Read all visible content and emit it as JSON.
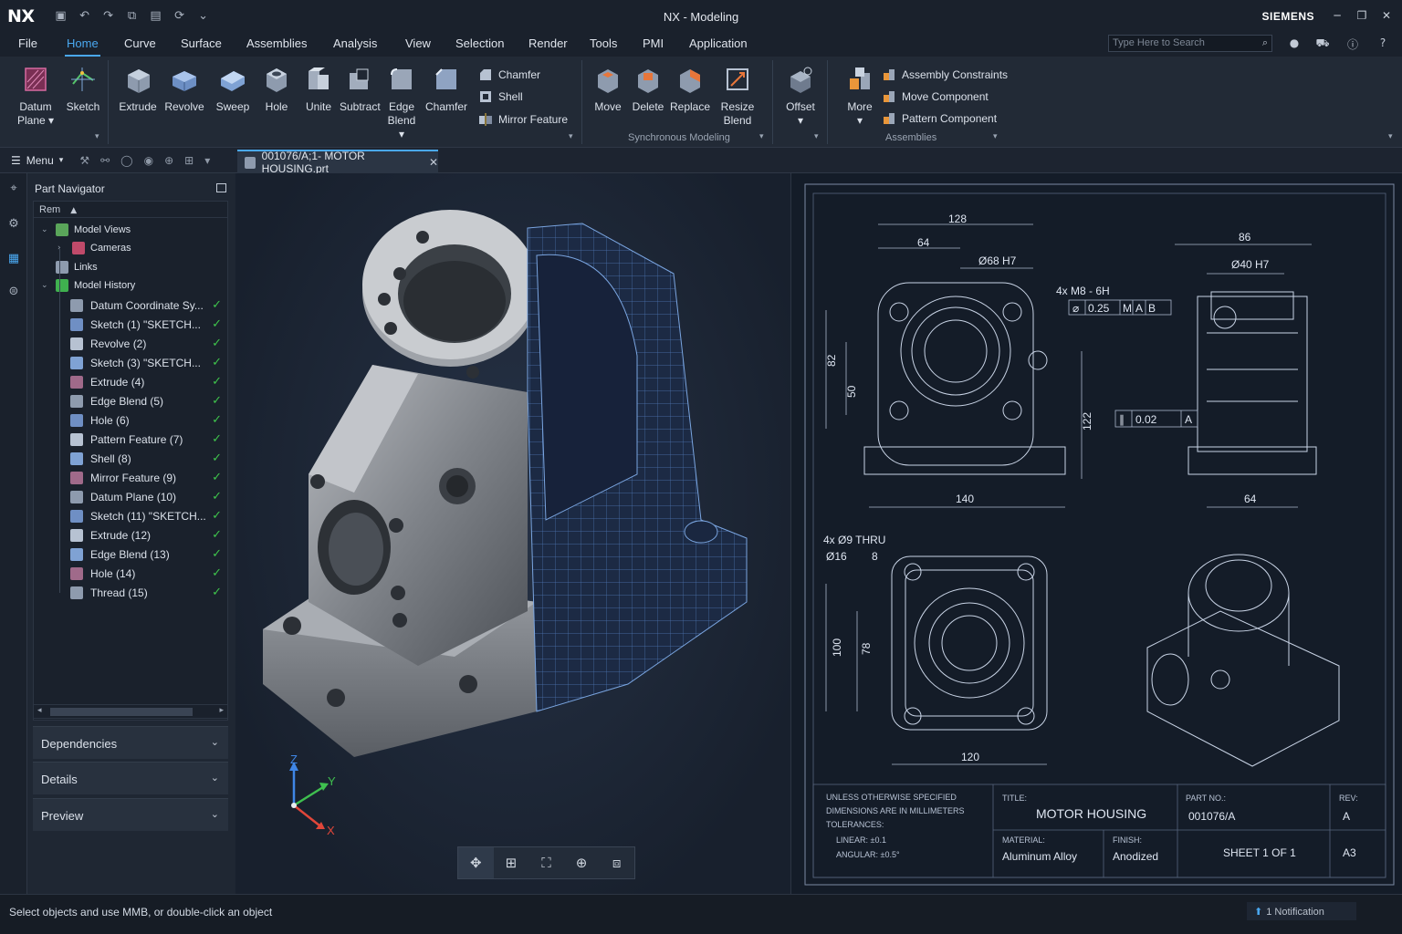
{
  "titlebar": {
    "logo": "NX",
    "title": "NX - Modeling",
    "brand": "SIEMENS"
  },
  "menubar": {
    "items": [
      "File",
      "Home",
      "Curve",
      "Surface",
      "Assemblies",
      "Analysis",
      "View",
      "Selection",
      "Render",
      "Tools",
      "PMI",
      "Application"
    ],
    "active": "Home",
    "search_placeholder": "Type Here to Search"
  },
  "ribbon": {
    "buttons": [
      {
        "label": "Datum",
        "label2": "Plane ▾"
      },
      {
        "label": "Sketch"
      },
      {
        "label": "Extrude"
      },
      {
        "label": "Revolve"
      },
      {
        "label": "Sweep"
      },
      {
        "label": "Hole"
      },
      {
        "label": "Unite"
      },
      {
        "label": "Subtract"
      },
      {
        "label": "Edge",
        "label2": "Blend ▾"
      },
      {
        "label": "Chamfer"
      },
      {
        "label": "Move"
      },
      {
        "label": "Delete"
      },
      {
        "label": "Replace"
      },
      {
        "label": "Resize",
        "label2": "Blend"
      },
      {
        "label": "Offset",
        "label2": "▾"
      },
      {
        "label": "More",
        "label2": "▾"
      }
    ],
    "small_features": [
      "Chamfer",
      "Shell",
      "Mirror Feature"
    ],
    "small_assemblies": [
      "Assembly Constraints",
      "Move Component",
      "Pattern Component"
    ],
    "groups": {
      "sync": "Synchronous Modeling",
      "assemblies": "Assemblies"
    }
  },
  "toolbar": {
    "menu_label": "Menu"
  },
  "doc_tab": {
    "label": "001076/A;1- MOTOR HOUSING.prt"
  },
  "navigator": {
    "title": "Part Navigator",
    "column": "Rem",
    "top_items": [
      {
        "label": "Model Views"
      },
      {
        "label": "Cameras"
      },
      {
        "label": "Links"
      },
      {
        "label": "Model History"
      }
    ],
    "history": [
      "Datum Coordinate Sy...",
      "Sketch (1) \"SKETCH...",
      "Revolve (2)",
      "Sketch (3) \"SKETCH...",
      "Extrude (4)",
      "Edge Blend (5)",
      "Hole (6)",
      "Pattern Feature (7)",
      "Shell (8)",
      "Mirror Feature (9)",
      "Datum Plane (10)",
      "Sketch (11) \"SKETCH...",
      "Extrude (12)",
      "Edge Blend (13)",
      "Hole (14)",
      "Thread (15)"
    ],
    "panels": [
      "Dependencies",
      "Details",
      "Preview"
    ]
  },
  "triad": {
    "x": "X",
    "y": "Y",
    "z": "Z"
  },
  "drawing": {
    "dims": {
      "d128": "128",
      "d64": "64",
      "d68": "Ø68 H7",
      "d4xm8": "4x M8 - 6H",
      "fcf1": "0.25",
      "fcf1m": "M",
      "fcf1a": "A",
      "fcf1b": "B",
      "d82": "82",
      "d50": "50",
      "d122": "122",
      "d140": "140",
      "d86": "86",
      "d40": "Ø40 H7",
      "fcf2": "0.02",
      "fcf2a": "A",
      "d64b": "64",
      "d4x9": "4x Ø9 THRU",
      "d16": "Ø16",
      "d8": "8",
      "d100": "100",
      "d78": "78",
      "d120": "120"
    },
    "titleblock": {
      "notes": [
        "UNLESS OTHERWISE SPECIFIED",
        "DIMENSIONS ARE IN MILLIMETERS",
        "TOLERANCES:",
        "LINEAR:  ±0.1",
        "ANGULAR:  ±0.5°"
      ],
      "title_label": "TITLE:",
      "title": "MOTOR HOUSING",
      "partno_label": "PART NO.:",
      "partno": "001076/A",
      "rev_label": "REV:",
      "rev": "A",
      "material_label": "MATERIAL:",
      "material": "Aluminum Alloy",
      "finish_label": "FINISH:",
      "finish": "Anodized",
      "sheet": "SHEET 1 OF 1",
      "size": "A3"
    }
  },
  "status": {
    "text": "Select objects and use MMB, or double-click an object",
    "notification": "1 Notification"
  }
}
